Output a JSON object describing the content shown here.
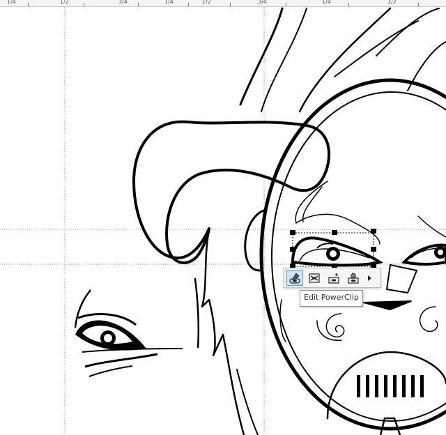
{
  "ruler": {
    "labels": [
      "1/4",
      "1/2",
      "3/4",
      "1/4",
      "1/2",
      "3/4",
      "1/4",
      "1/2"
    ]
  },
  "context_toolbar": {
    "buttons": [
      {
        "name": "edit-powerclip",
        "icon": "edit-powerclip-icon",
        "active": true
      },
      {
        "name": "select-contents",
        "icon": "select-contents-icon",
        "active": false
      },
      {
        "name": "extract-contents",
        "icon": "extract-contents-icon",
        "active": false
      },
      {
        "name": "lock-contents",
        "icon": "lock-contents-icon",
        "active": false
      }
    ],
    "more_icon": "chevron-right-icon"
  },
  "tooltip": {
    "text": "Edit PowerClip"
  },
  "colors": {
    "guide": "#8a8ad8",
    "selection_handle": "#000000",
    "active_button": "#cfe5fb",
    "active_border": "#5b9bd5"
  }
}
